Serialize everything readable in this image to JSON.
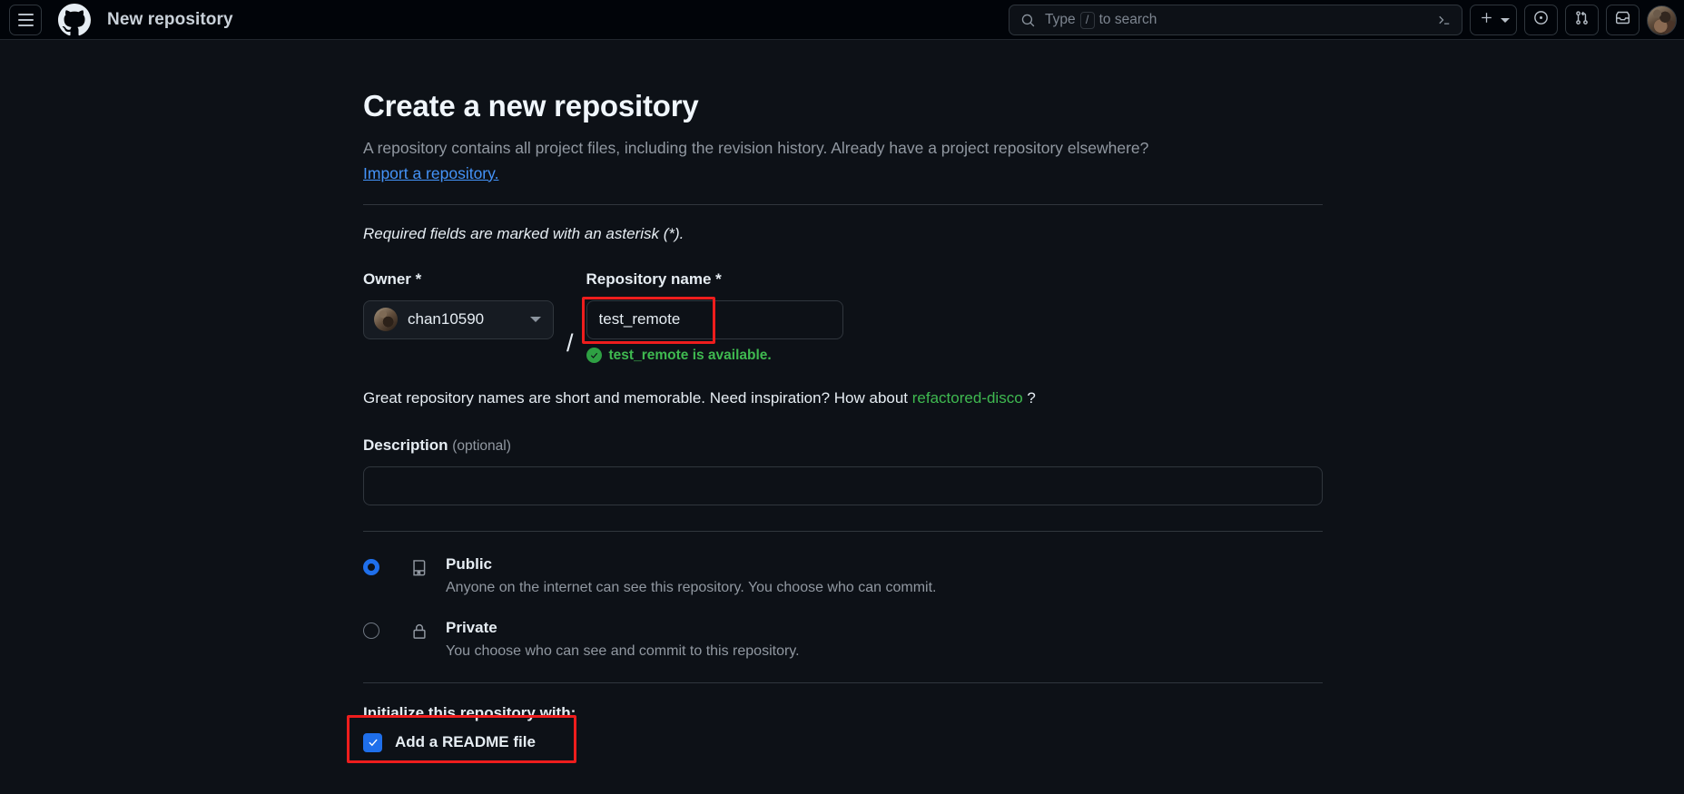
{
  "header": {
    "menu_icon": "hamburger-menu-icon",
    "logo_icon": "github-logo-icon",
    "title": "New repository",
    "search": {
      "icon": "search-icon",
      "placeholder_prefix": "Type",
      "key_hint": "/",
      "placeholder_suffix": "to search",
      "terminal_icon": "command-palette-terminal-icon"
    },
    "actions": [
      {
        "name": "create-new-button",
        "icon": "plus-icon",
        "has_caret": true
      },
      {
        "name": "issues-button",
        "icon": "issue-opened-icon",
        "has_caret": false
      },
      {
        "name": "pull-requests-button",
        "icon": "git-pull-request-icon",
        "has_caret": false
      },
      {
        "name": "inbox-button",
        "icon": "inbox-icon",
        "has_caret": false
      }
    ],
    "avatar": "user-avatar"
  },
  "main": {
    "heading": "Create a new repository",
    "subtitle": "A repository contains all project files, including the revision history. Already have a project repository elsewhere?",
    "import_link": "Import a repository.",
    "required_note": "Required fields are marked with an asterisk (*).",
    "owner": {
      "label": "Owner *",
      "value": "chan10590",
      "caret_icon": "chevron-down-icon"
    },
    "separator": "/",
    "repo_name": {
      "label": "Repository name *",
      "value": "test_remote",
      "availability_text": "test_remote is available.",
      "availability_icon": "check-circle-icon",
      "availability_color": "#3fb950"
    },
    "inspiration": {
      "prefix": "Great repository names are short and memorable. Need inspiration? How about",
      "suggestion": "refactored-disco",
      "suffix": "?"
    },
    "description": {
      "label": "Description",
      "optional": "(optional)",
      "value": "",
      "placeholder": ""
    },
    "visibility": [
      {
        "id": "public",
        "icon": "repo-book-icon",
        "title": "Public",
        "description": "Anyone on the internet can see this repository. You choose who can commit.",
        "selected": true
      },
      {
        "id": "private",
        "icon": "lock-icon",
        "title": "Private",
        "description": "You choose who can see and commit to this repository.",
        "selected": false
      }
    ],
    "initialize": {
      "title": "Initialize this repository with:",
      "readme_label": "Add a README file",
      "readme_checked": true
    }
  },
  "colors": {
    "header_bg": "#010409",
    "body_bg": "#0d1117",
    "accent_blue": "#1f6feb",
    "link_blue": "#4493f8",
    "success_green": "#3fb950",
    "highlight_red": "#ee1d1d",
    "border": "#30363d",
    "text_primary": "#e6edf3",
    "text_muted": "#9198a1"
  }
}
